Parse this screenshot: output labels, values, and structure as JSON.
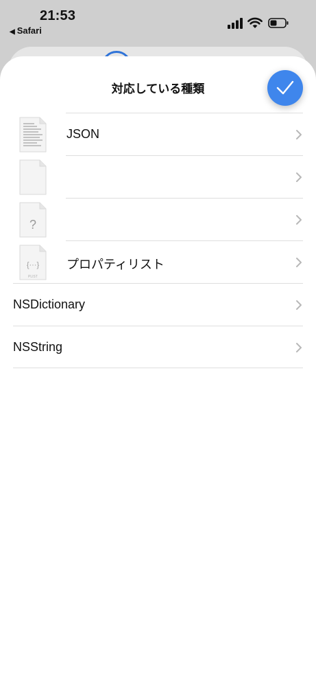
{
  "status": {
    "time": "21:53",
    "back_app": "Safari"
  },
  "sheet": {
    "title": "対応している種類",
    "done_icon": "checkmark-icon",
    "accent": "#3f86ec"
  },
  "rows": [
    {
      "label": "JSON",
      "icon": "text-document-icon"
    },
    {
      "label": "",
      "icon": "blank-document-icon"
    },
    {
      "label": "",
      "icon": "unknown-document-icon",
      "icon_glyph": "?"
    },
    {
      "label": "プロパティリスト",
      "icon": "plist-document-icon",
      "icon_glyph": "{···}",
      "icon_caption": "PLIST"
    },
    {
      "label": "NSDictionary"
    },
    {
      "label": "NSString"
    }
  ]
}
